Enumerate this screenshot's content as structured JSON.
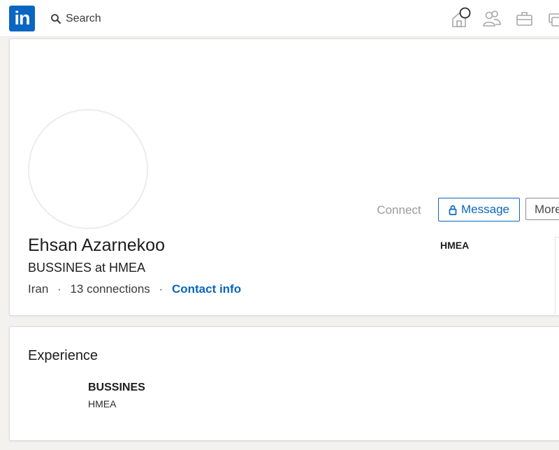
{
  "header": {
    "logo_text": "in",
    "search_label": "Search",
    "icons": [
      "home-icon",
      "my-network-icon",
      "jobs-icon",
      "messaging-icon"
    ]
  },
  "profile": {
    "name": "Ehsan Azarnekoo",
    "headline": "BUSSINES at HMEA",
    "location": "Iran",
    "connections": "13 connections",
    "contact_info": "Contact info",
    "separator": "·",
    "company": "HMEA",
    "actions": {
      "connect": "Connect",
      "message": "Message",
      "more": "More"
    }
  },
  "experience": {
    "title": "Experience",
    "items": [
      {
        "role": "BUSSINES",
        "company": "HMEA"
      }
    ]
  },
  "colors": {
    "brand": "#0a66c2",
    "background": "#f3f2ef"
  }
}
